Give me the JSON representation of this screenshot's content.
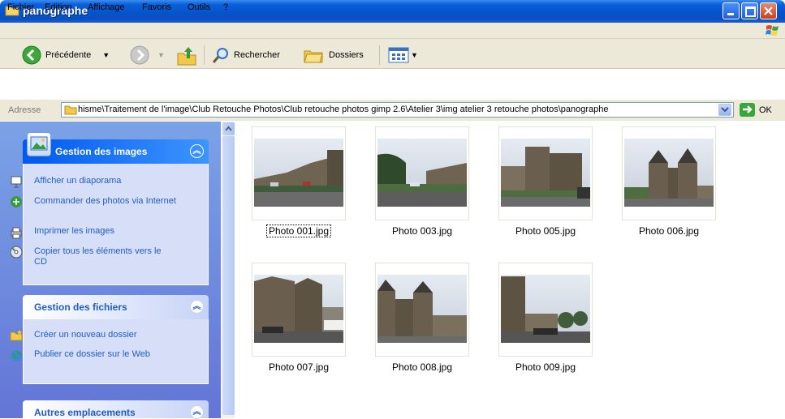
{
  "window": {
    "title": "panographe"
  },
  "menu": [
    "Fichier",
    "Edition",
    "Affichage",
    "Favoris",
    "Outils",
    "?"
  ],
  "toolbar": {
    "back_label": "Précédente",
    "search_label": "Rechercher",
    "folders_label": "Dossiers"
  },
  "address": {
    "label": "Adresse",
    "path": "hisme\\Traitement de l'image\\Club Retouche Photos\\Club retouche photos gimp 2.6\\Atelier 3\\img atelier 3 retouche photos\\panographe",
    "go_label": "OK"
  },
  "panels": {
    "images": {
      "title": "Gestion des images",
      "links": [
        "Afficher un diaporama",
        "Commander des photos via Internet",
        "Imprimer les images",
        "Copier tous les éléments vers le CD"
      ]
    },
    "files": {
      "title": "Gestion des fichiers",
      "links": [
        "Créer un nouveau dossier",
        "Publier ce dossier sur le Web"
      ]
    },
    "other": {
      "title": "Autres emplacements"
    }
  },
  "files": [
    {
      "name": "Photo 001.jpg",
      "selected": true
    },
    {
      "name": "Photo 003.jpg"
    },
    {
      "name": "Photo 005.jpg"
    },
    {
      "name": "Photo 006.jpg"
    },
    {
      "name": "Photo 007.jpg"
    },
    {
      "name": "Photo 008.jpg"
    },
    {
      "name": "Photo 009.jpg"
    }
  ],
  "colors": {
    "titlebar": "#0553c9",
    "panel_bg": "#7ba2e7",
    "link": "#215dc6"
  }
}
